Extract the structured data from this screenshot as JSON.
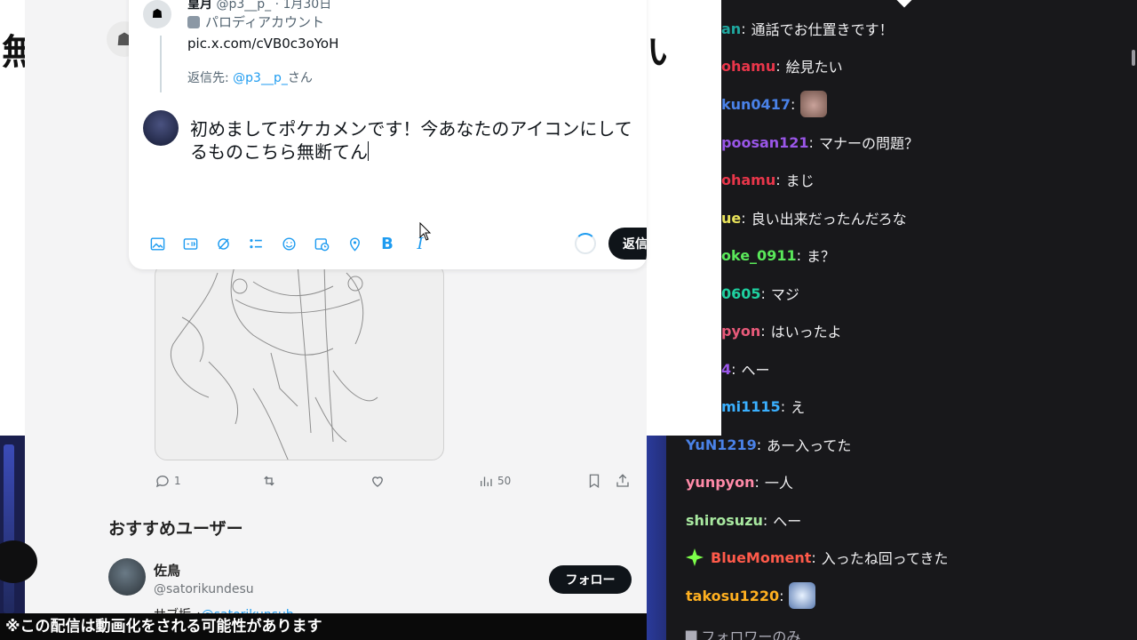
{
  "background": {
    "left_char": "無",
    "right_char": "い",
    "notice": "※この配信は動画化をされる可能性があります"
  },
  "composer": {
    "orig_name": "皇月",
    "orig_handle_date": "@p3__p_ · 1月30日",
    "parody_label": "パロディアカウント",
    "pic_link": "pic.x.com/cVB0c3oYoH",
    "reply_to_prefix": "返信先: ",
    "reply_to_handle": "@p3__p_",
    "reply_to_suffix": "さん",
    "draft_text": "初めましてポケカメンです！今あなたのアイコンにしてるものこちら無断てん",
    "reply_button": "返信",
    "toolbar_icons": [
      "image-icon",
      "gif-icon",
      "grok-icon",
      "poll-icon",
      "emoji-icon",
      "schedule-icon",
      "location-icon",
      "bold-icon",
      "italic-icon"
    ]
  },
  "timeline": {
    "reply_count": "1",
    "view_count": "50",
    "recommended_title": "おすすめユーザー",
    "recommended_user": {
      "name": "佐鳥",
      "handle": "@satorikundesu",
      "bio_prefix": "サブ垢→",
      "bio_link": "@satorikunsub",
      "follow_label": "フォロー"
    }
  },
  "chat": {
    "messages": [
      {
        "user": "an",
        "color": "#1fa8a0",
        "text": "通話でお仕置きです！"
      },
      {
        "user": "ohamu",
        "color": "#e8364a",
        "text": "絵見たい"
      },
      {
        "user": "kun0417",
        "color": "#4a82e8",
        "text": "",
        "emote": "fish-emote"
      },
      {
        "user": "poosan121",
        "color": "#9a56e8",
        "text": "マナーの問題？"
      },
      {
        "user": "ohamu",
        "color": "#e8364a",
        "text": "まじ"
      },
      {
        "user": "ue",
        "color": "#e8e25a",
        "text": "良い出来だったんだろな"
      },
      {
        "user": "oke_0911",
        "color": "#5ae85a",
        "text": "ま？"
      },
      {
        "user": "0605",
        "color": "#1fd0a0",
        "text": "マジ"
      },
      {
        "user": "pyon",
        "color": "#e85a7a",
        "text": "はいったよ"
      },
      {
        "user": "4",
        "color": "#9a56e8",
        "text": "へー"
      },
      {
        "user": "mi1115",
        "color": "#3ab0ff",
        "text": "え"
      },
      {
        "user": "YuN1219",
        "color": "#4a82e8",
        "text": "あー入ってた"
      },
      {
        "user": "yunpyon",
        "color": "#ff8aa8",
        "text": "一人"
      },
      {
        "user": "shirosuzu",
        "color": "#a8e8a0",
        "text": "へー"
      },
      {
        "user": "BlueMoment",
        "color": "#ff5a4a",
        "text": "入ったね回ってきた",
        "badge": "star-badge-icon"
      },
      {
        "user": "takosu1220",
        "color": "#ffb020",
        "text": "",
        "emote": "face-emote"
      }
    ],
    "footer": "フォロワーのみ"
  }
}
